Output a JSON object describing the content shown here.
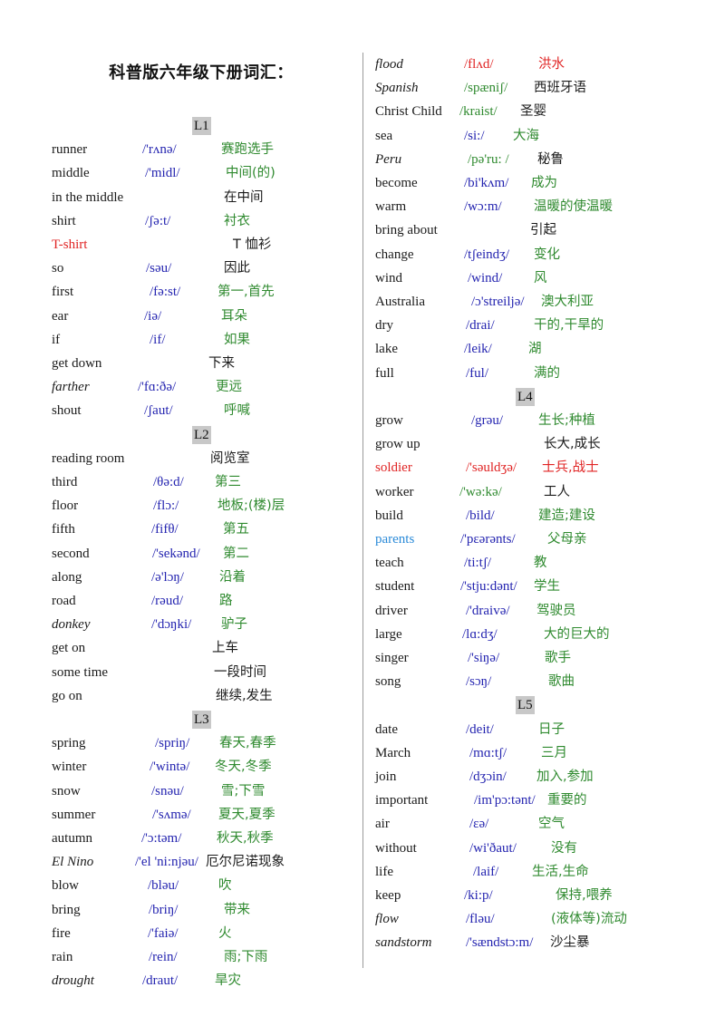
{
  "title": "科普版六年级下册词汇：",
  "colors": {
    "word": "#1a1a1a",
    "phonetic": "#2424b0",
    "meaning_green": "#2f8a2f",
    "highlight_red": "#e02424",
    "highlight_blue": "#2a8ad8",
    "lesson_badge_bg": "#c8c8c8",
    "divider": "#9a9a9a"
  },
  "left_column": [
    {
      "type": "lesson",
      "label": "L1"
    },
    {
      "word": "runner",
      "phonetic": "/'rʌnə/",
      "meaning": "赛跑选手",
      "wc": "black",
      "pc": "blue",
      "mc": "green"
    },
    {
      "word": "middle",
      "phonetic": "/'midl/",
      "meaning": "中间(的)",
      "wc": "black",
      "pc": "blue",
      "mc": "green"
    },
    {
      "word": "in the middle",
      "phonetic": "",
      "meaning": "在中间",
      "wc": "black",
      "pc": "blue",
      "mc": "black"
    },
    {
      "word": "shirt",
      "phonetic": "/ʃə:t/",
      "meaning": "衬衣",
      "wc": "black",
      "pc": "blue",
      "mc": "green"
    },
    {
      "word": "T-shirt",
      "phonetic": "",
      "meaning": "T 恤衫",
      "wc": "red",
      "pc": "blue",
      "mc": "black"
    },
    {
      "word": "so",
      "phonetic": "/səu/",
      "meaning": "因此",
      "wc": "black",
      "pc": "blue",
      "mc": "black"
    },
    {
      "word": "first",
      "phonetic": "/fə:st/",
      "meaning": "第一,首先",
      "wc": "black",
      "pc": "blue",
      "mc": "green"
    },
    {
      "word": "ear",
      "phonetic": "/iə/",
      "meaning": "耳朵",
      "wc": "black",
      "pc": "blue",
      "mc": "green"
    },
    {
      "word": "if",
      "phonetic": "/if/",
      "meaning": "如果",
      "wc": "black",
      "pc": "blue",
      "mc": "green"
    },
    {
      "word": "get down",
      "phonetic": "",
      "meaning": "下来",
      "wc": "black",
      "pc": "blue",
      "mc": "black"
    },
    {
      "word": "farther",
      "phonetic": "/'fɑ:ðə/",
      "meaning": "更远",
      "wc": "black",
      "pc": "blue",
      "mc": "green",
      "italic": true
    },
    {
      "word": "shout",
      "phonetic": "/ʃaut/",
      "meaning": "呼喊",
      "wc": "black",
      "pc": "blue",
      "mc": "green"
    },
    {
      "type": "lesson",
      "label": "L2"
    },
    {
      "word": "reading room",
      "phonetic": "",
      "meaning": "阅览室",
      "wc": "black",
      "pc": "blue",
      "mc": "black"
    },
    {
      "word": "third",
      "phonetic": "/θə:d/",
      "meaning": "第三",
      "wc": "black",
      "pc": "blue",
      "mc": "green"
    },
    {
      "word": "floor",
      "phonetic": "/flɔ:/",
      "meaning": "地板;(楼)层",
      "wc": "black",
      "pc": "blue",
      "mc": "green"
    },
    {
      "word": "fifth",
      "phonetic": "/fifθ/",
      "meaning": "第五",
      "wc": "black",
      "pc": "blue",
      "mc": "green"
    },
    {
      "word": "second",
      "phonetic": "/'sekənd/",
      "meaning": "第二",
      "wc": "black",
      "pc": "blue",
      "mc": "green"
    },
    {
      "word": "along",
      "phonetic": "/ə'lɔŋ/",
      "meaning": "沿着",
      "wc": "black",
      "pc": "blue",
      "mc": "green"
    },
    {
      "word": "road",
      "phonetic": "/rəud/",
      "meaning": "路",
      "wc": "black",
      "pc": "blue",
      "mc": "green"
    },
    {
      "word": "donkey",
      "phonetic": "/'dɔŋki/",
      "meaning": "驴子",
      "wc": "black",
      "pc": "blue",
      "mc": "green",
      "italic": true
    },
    {
      "word": "get on",
      "phonetic": "",
      "meaning": "上车",
      "wc": "black",
      "pc": "blue",
      "mc": "black"
    },
    {
      "word": "some time",
      "phonetic": "",
      "meaning": "一段时间",
      "wc": "black",
      "pc": "blue",
      "mc": "black"
    },
    {
      "word": "go on",
      "phonetic": "",
      "meaning": "继续,发生",
      "wc": "black",
      "pc": "blue",
      "mc": "black"
    },
    {
      "type": "lesson",
      "label": "L3"
    },
    {
      "word": "spring",
      "phonetic": "/spriŋ/",
      "meaning": "春天,春季",
      "wc": "black",
      "pc": "blue",
      "mc": "green"
    },
    {
      "word": "winter",
      "phonetic": "/'wintə/",
      "meaning": "冬天,冬季",
      "wc": "black",
      "pc": "blue",
      "mc": "green"
    },
    {
      "word": "snow",
      "phonetic": "/snəu/",
      "meaning": "雪;下雪",
      "wc": "black",
      "pc": "blue",
      "mc": "green"
    },
    {
      "word": "summer",
      "phonetic": "/'sʌmə/",
      "meaning": "夏天,夏季",
      "wc": "black",
      "pc": "blue",
      "mc": "green"
    },
    {
      "word": "autumn",
      "phonetic": "/'ɔ:təm/",
      "meaning": "秋天,秋季",
      "wc": "black",
      "pc": "blue",
      "mc": "green"
    },
    {
      "word": "El Nino",
      "phonetic": "/'el 'ni:njəu/",
      "meaning": "厄尔尼诺现象",
      "wc": "black",
      "pc": "blue",
      "mc": "black",
      "italic": true
    },
    {
      "word": "blow",
      "phonetic": "/bləu/",
      "meaning": "吹",
      "wc": "black",
      "pc": "blue",
      "mc": "green"
    },
    {
      "word": "bring",
      "phonetic": "/briŋ/",
      "meaning": "带来",
      "wc": "black",
      "pc": "blue",
      "mc": "green"
    },
    {
      "word": "fire",
      "phonetic": "/'faiə/",
      "meaning": "火",
      "wc": "black",
      "pc": "blue",
      "mc": "green"
    },
    {
      "word": "rain",
      "phonetic": "/rein/",
      "meaning": "雨;下雨",
      "wc": "black",
      "pc": "blue",
      "mc": "green"
    },
    {
      "word": "drought",
      "phonetic": "/draut/",
      "meaning": "旱灾",
      "wc": "black",
      "pc": "blue",
      "mc": "green",
      "italic": true
    }
  ],
  "right_column": [
    {
      "word": "flood",
      "phonetic": "/flʌd/",
      "meaning": "洪水",
      "wc": "black",
      "pc": "red",
      "mc": "red",
      "italic": true
    },
    {
      "word": "Spanish",
      "phonetic": "/spæniʃ/",
      "meaning": "西班牙语",
      "wc": "black",
      "pc": "green",
      "mc": "black",
      "italic": true
    },
    {
      "word": "Christ Child",
      "phonetic": "/kraist/",
      "meaning": "圣婴",
      "wc": "black",
      "pc": "green",
      "mc": "black"
    },
    {
      "word": "sea",
      "phonetic": "/si:/",
      "meaning": "大海",
      "wc": "black",
      "pc": "blue",
      "mc": "green"
    },
    {
      "word": "Peru",
      "phonetic": "/pə'ru: /",
      "meaning": "秘鲁",
      "wc": "black",
      "pc": "green",
      "mc": "black",
      "italic": true
    },
    {
      "word": "become",
      "phonetic": "/bi'kʌm/",
      "meaning": "成为",
      "wc": "black",
      "pc": "blue",
      "mc": "green"
    },
    {
      "word": "warm",
      "phonetic": "/wɔ:m/",
      "meaning": "温暖的使温暖",
      "wc": "black",
      "pc": "blue",
      "mc": "green"
    },
    {
      "word": "bring about",
      "phonetic": "",
      "meaning": "引起",
      "wc": "black",
      "pc": "blue",
      "mc": "black"
    },
    {
      "word": "change",
      "phonetic": "/tʃeindʒ/",
      "meaning": "变化",
      "wc": "black",
      "pc": "blue",
      "mc": "green"
    },
    {
      "word": "wind",
      "phonetic": "/wind/",
      "meaning": "风",
      "wc": "black",
      "pc": "blue",
      "mc": "green"
    },
    {
      "word": "Australia",
      "phonetic": "/ɔ'streiljə/",
      "meaning": "澳大利亚",
      "wc": "black",
      "pc": "blue",
      "mc": "green"
    },
    {
      "word": "dry",
      "phonetic": "/drai/",
      "meaning": "干的,干旱的",
      "wc": "black",
      "pc": "blue",
      "mc": "green"
    },
    {
      "word": "lake",
      "phonetic": "/leik/",
      "meaning": "湖",
      "wc": "black",
      "pc": "blue",
      "mc": "green"
    },
    {
      "word": "full",
      "phonetic": "/ful/",
      "meaning": "满的",
      "wc": "black",
      "pc": "blue",
      "mc": "green"
    },
    {
      "type": "lesson",
      "label": "L4"
    },
    {
      "word": "grow",
      "phonetic": "/grəu/",
      "meaning": "生长;种植",
      "wc": "black",
      "pc": "blue",
      "mc": "green"
    },
    {
      "word": "grow up",
      "phonetic": "",
      "meaning": "长大,成长",
      "wc": "black",
      "pc": "blue",
      "mc": "black"
    },
    {
      "word": "soldier",
      "phonetic": "/'səuldʒə/",
      "meaning": "士兵,战士",
      "wc": "red",
      "pc": "red",
      "mc": "red"
    },
    {
      "word": "worker",
      "phonetic": "/'wə:kə/",
      "meaning": "工人",
      "wc": "black",
      "pc": "green",
      "mc": "black"
    },
    {
      "word": "build",
      "phonetic": "/bild/",
      "meaning": "建造;建设",
      "wc": "black",
      "pc": "blue",
      "mc": "green"
    },
    {
      "word": "parents",
      "phonetic": "/'pɛərənts/",
      "meaning": "父母亲",
      "wc": "lblue",
      "pc": "blue",
      "mc": "green"
    },
    {
      "word": "teach",
      "phonetic": "/ti:tʃ/",
      "meaning": "教",
      "wc": "black",
      "pc": "blue",
      "mc": "green"
    },
    {
      "word": "student",
      "phonetic": "/'stju:dənt/",
      "meaning": "学生",
      "wc": "black",
      "pc": "blue",
      "mc": "green"
    },
    {
      "word": "driver",
      "phonetic": "/'draivə/",
      "meaning": "驾驶员",
      "wc": "black",
      "pc": "blue",
      "mc": "green"
    },
    {
      "word": "large",
      "phonetic": "/lɑ:dʒ/",
      "meaning": "大的巨大的",
      "wc": "black",
      "pc": "blue",
      "mc": "green"
    },
    {
      "word": "singer",
      "phonetic": "/'siŋə/",
      "meaning": "歌手",
      "wc": "black",
      "pc": "blue",
      "mc": "green"
    },
    {
      "word": "song",
      "phonetic": "/sɔŋ/",
      "meaning": "歌曲",
      "wc": "black",
      "pc": "blue",
      "mc": "green"
    },
    {
      "type": "lesson",
      "label": "L5"
    },
    {
      "word": "date",
      "phonetic": "/deit/",
      "meaning": "日子",
      "wc": "black",
      "pc": "blue",
      "mc": "green"
    },
    {
      "word": "March",
      "phonetic": "/mɑ:tʃ/",
      "meaning": "三月",
      "wc": "black",
      "pc": "blue",
      "mc": "green"
    },
    {
      "word": "join",
      "phonetic": "/dʒɔin/",
      "meaning": "加入,参加",
      "wc": "black",
      "pc": "blue",
      "mc": "green"
    },
    {
      "word": "important",
      "phonetic": "/im'pɔ:tənt/",
      "meaning": "重要的",
      "wc": "black",
      "pc": "blue",
      "mc": "green"
    },
    {
      "word": "air",
      "phonetic": "/ɛə/",
      "meaning": "空气",
      "wc": "black",
      "pc": "blue",
      "mc": "green"
    },
    {
      "word": "without",
      "phonetic": "/wi'ðaut/",
      "meaning": "没有",
      "wc": "black",
      "pc": "blue",
      "mc": "green"
    },
    {
      "word": "life",
      "phonetic": "/laif/",
      "meaning": "生活,生命",
      "wc": "black",
      "pc": "blue",
      "mc": "green"
    },
    {
      "word": "keep",
      "phonetic": "/ki:p/",
      "meaning": "保持,喂养",
      "wc": "black",
      "pc": "blue",
      "mc": "green"
    },
    {
      "word": "flow",
      "phonetic": "/fləu/",
      "meaning": "(液体等)流动",
      "wc": "black",
      "pc": "blue",
      "mc": "green",
      "italic": true
    },
    {
      "word": "sandstorm",
      "phonetic": "/'sændstɔ:m/",
      "meaning": "沙尘暴",
      "wc": "black",
      "pc": "blue",
      "mc": "black",
      "italic": true
    }
  ]
}
